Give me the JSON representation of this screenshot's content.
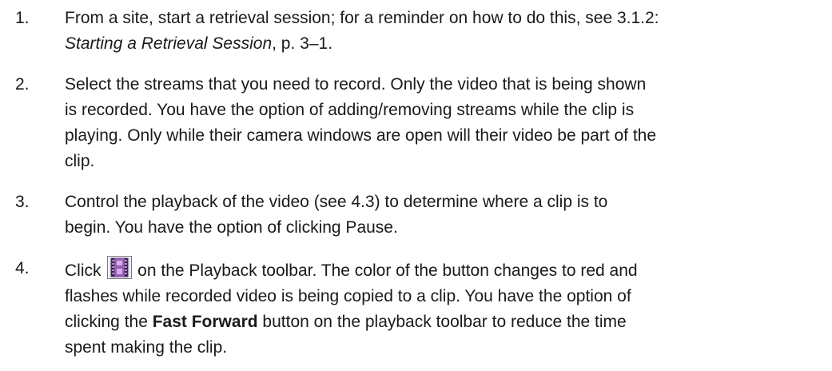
{
  "steps": [
    {
      "number": "1.",
      "lines": [
        [
          "From a site, start a retrieval session; for a reminder on how to do this, see 3.1.2:"
        ],
        [
          "Starting a Retrieval Session",
          ", p. 3–1."
        ]
      ]
    },
    {
      "number": "2.",
      "lines": [
        "Select the streams that you need to record. Only the video that is being shown",
        "is recorded. You have the option of adding/removing streams while the clip is",
        "playing. Only while their camera windows are open will their video be part of the",
        "clip."
      ]
    },
    {
      "number": "3.",
      "lines": [
        "Control the playback of the video (see 4.3) to determine where a clip is to",
        "begin. You have the option of clicking Pause."
      ]
    },
    {
      "number": "4.",
      "line1_before": "Click ",
      "icon": "film-clip-icon",
      "line1_after": " on the Playback toolbar. The color of the button changes to red and",
      "line2": "flashes while recorded video is being copied to a clip. You have the option of",
      "line3_before": "clicking the ",
      "line3_bold": "Fast Forward",
      "line3_after": " button on the playback toolbar to reduce the time",
      "line4": "spent making the clip."
    }
  ],
  "colors": {
    "text": "#1a1a1a",
    "icon_fill": "#c98ee6",
    "icon_frame": "#5a2a7a"
  }
}
